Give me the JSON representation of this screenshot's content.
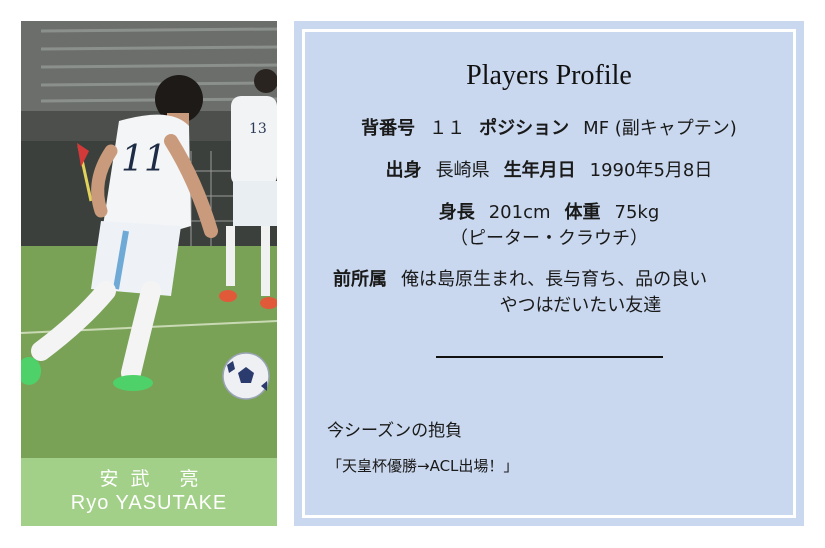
{
  "player": {
    "name_jp": "安武 亮",
    "name_en": "Ryo YASUTAKE"
  },
  "profile": {
    "title": "Players Profile",
    "number_label": "背番号",
    "number_value": "１１",
    "position_label": "ポジション",
    "position_value": "MF (副キャプテン)",
    "birthplace_label": "出身",
    "birthplace_value": "長崎県",
    "birthday_label": "生年月日",
    "birthday_value": "1990年5月8日",
    "height_label": "身長",
    "height_value": "201cm",
    "weight_label": "体重",
    "weight_value": "75kg",
    "weight_note": "（ピーター・クラウチ）",
    "previous_label": "前所属",
    "previous_value_line1": "俺は島原生まれ、長与育ち、品の良い",
    "previous_value_line2": "やつはだいたい友達",
    "season_label": "今シーズンの抱負",
    "season_goal": "「天皇杯優勝→ACL出場！」"
  },
  "colors": {
    "name_plate_bg": "#a2d088",
    "panel_bg": "#c9d8ef",
    "panel_border": "#ffffff"
  }
}
